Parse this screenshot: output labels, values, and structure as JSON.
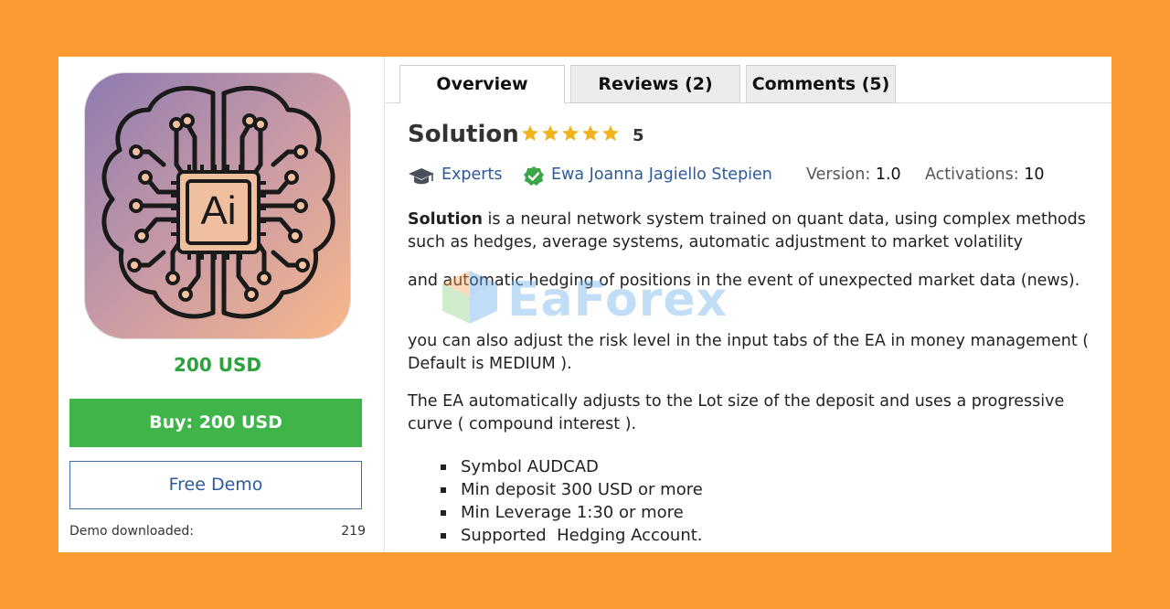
{
  "product": {
    "price": "200 USD",
    "buy_label": "Buy: 200 USD",
    "demo_label": "Free Demo",
    "demo_downloaded_label": "Demo downloaded:",
    "demo_downloaded_count": "219",
    "image_text": "Ai"
  },
  "tabs": [
    {
      "label": "Overview",
      "active": true
    },
    {
      "label": "Reviews (2)",
      "active": false
    },
    {
      "label": "Comments (5)",
      "active": false
    }
  ],
  "header": {
    "title": "Solution",
    "rating": "5",
    "stars": 5
  },
  "meta": {
    "category": "Experts",
    "author": "Ewa Joanna Jagiello Stepien",
    "version_label": "Version:",
    "version": "1.0",
    "activations_label": "Activations:",
    "activations": "10"
  },
  "description": {
    "p1_bold": "Solution",
    "p1_rest": " is a neural network system trained on quant data, using complex methods such as hedges, average systems, automatic adjustment to market volatility",
    "p2": "and automatic hedging of positions in the event of unexpected market data (news).",
    "p3": "you can also adjust the risk level in the input tabs of the EA in money management ( Default is MEDIUM ).",
    "p4": "The EA automatically adjusts to the Lot size of the deposit and uses a progressive curve ( compound interest ).",
    "bullets": [
      "Symbol AUDCAD",
      "Min deposit 300 USD or more",
      "Min Leverage 1:30 or more",
      "Supported  Hedging Account."
    ]
  },
  "watermark": {
    "text": "EaForex"
  },
  "colors": {
    "background": "#fc9a32",
    "price_green": "#2aa33c",
    "buy_button": "#3eb449",
    "link_blue": "#2c5a9a",
    "star": "#f2b21c"
  }
}
